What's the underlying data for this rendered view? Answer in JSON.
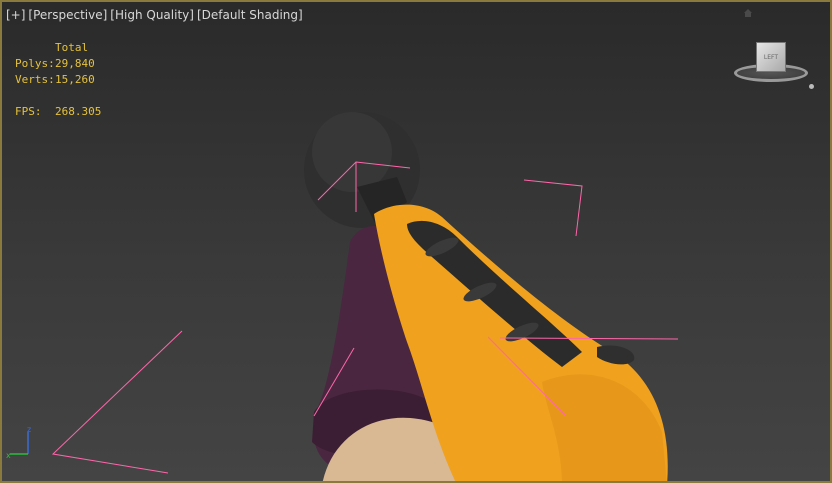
{
  "viewport": {
    "labels": [
      "[+]",
      "[Perspective]",
      "[High Quality]",
      "[Default Shading]"
    ]
  },
  "stats": {
    "header": "Total",
    "polys_label": "Polys:",
    "polys_value": "29,840",
    "verts_label": "Verts:",
    "verts_value": "15,260",
    "fps_label": "FPS:",
    "fps_value": "268.305"
  },
  "viewcube": {
    "face_label": "LEFT"
  },
  "axis_gizmo": {
    "z": "z",
    "x": "x"
  },
  "colors": {
    "stats_text": "#e6c23a",
    "viewport_border": "#8a7a3c",
    "glove_orange": "#f0a11d",
    "glove_purple": "#4a2640",
    "skin": "#d9b894",
    "selection_lines": "#ff66aa",
    "axis_z": "#3a6ad8",
    "axis_x": "#2bbd3a"
  }
}
